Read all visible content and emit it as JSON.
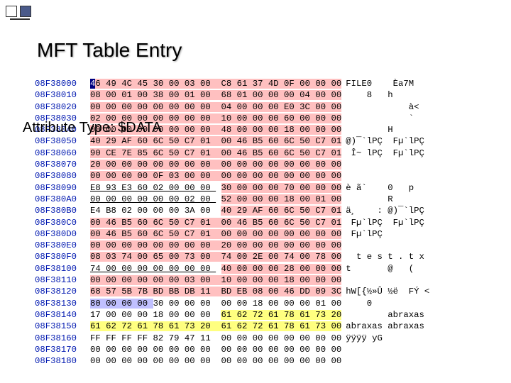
{
  "title": "MFT Table Entry",
  "label": "Attribute Type: $DATA",
  "colors": {
    "pink": "#ffc0c0",
    "blue": "#c0c0ff",
    "yellow": "#ffff80",
    "selection": "#000080",
    "address": "#0018b0"
  },
  "rows": [
    {
      "addr": "08F38000",
      "bytes": "46 49 4C 45 30 00 03 00  C8 61 37 4D 0F 00 00 00",
      "ascii": "FILE0    Èa7M     "
    },
    {
      "addr": "08F38010",
      "bytes": "08 00 01 00 38 00 01 00  68 01 00 00 00 04 00 00",
      "ascii": "    8   h         "
    },
    {
      "addr": "08F38020",
      "bytes": "00 00 00 00 00 00 00 00  04 00 00 00 E0 3C 00 00",
      "ascii": "            à<    "
    },
    {
      "addr": "08F38030",
      "bytes": "02 00 00 00 00 00 00 00  10 00 00 00 60 00 00 00",
      "ascii": "            `     "
    },
    {
      "addr": "08F38040",
      "bytes": "00 00 00 00 00 00 00 00  48 00 00 00 18 00 00 00",
      "ascii": "        H         "
    },
    {
      "addr": "08F38050",
      "bytes": "40 29 AF 60 6C 50 C7 01  00 46 B5 60 6C 50 C7 01",
      "ascii": "@)¯`lPÇ  Fµ`lPÇ"
    },
    {
      "addr": "08F38060",
      "bytes": "90 CE 7E 85 6C 50 C7 01  00 46 B5 60 6C 50 C7 01",
      "ascii": " Î~ lPÇ  Fµ`lPÇ"
    },
    {
      "addr": "08F38070",
      "bytes": "20 00 00 00 00 00 00 00  00 00 00 00 00 00 00 00",
      "ascii": "                  "
    },
    {
      "addr": "08F38080",
      "bytes": "00 00 00 00 0F 03 00 00  00 00 00 00 00 00 00 00",
      "ascii": "                  "
    },
    {
      "addr": "08F38090",
      "bytes": "E8 93 E3 60 02 00 00 00  30 00 00 00 70 00 00 00",
      "ascii": "è ã`    0   p     "
    },
    {
      "addr": "08F380A0",
      "bytes": "00 00 00 00 00 00 02 00  52 00 00 00 18 00 01 00",
      "ascii": "        R         "
    },
    {
      "addr": "08F380B0",
      "bytes": "E4 B8 02 00 00 00 3A 00  40 29 AF 60 6C 50 C7 01",
      "ascii": "ä¸    : @)¯`lPÇ"
    },
    {
      "addr": "08F380C0",
      "bytes": "00 46 B5 60 6C 50 C7 01  00 46 B5 60 6C 50 C7 01",
      "ascii": " Fµ`lPÇ  Fµ`lPÇ"
    },
    {
      "addr": "08F380D0",
      "bytes": "00 46 B5 60 6C 50 C7 01  00 00 00 00 00 00 00 00",
      "ascii": " Fµ`lPÇ          "
    },
    {
      "addr": "08F380E0",
      "bytes": "00 00 00 00 00 00 00 00  20 00 00 00 00 00 00 00",
      "ascii": "                  "
    },
    {
      "addr": "08F380F0",
      "bytes": "08 03 74 00 65 00 73 00  74 00 2E 00 74 00 78 00",
      "ascii": "  t e s t . t x "
    },
    {
      "addr": "08F38100",
      "bytes": "74 00 00 00 00 00 00 00  40 00 00 00 28 00 00 00",
      "ascii": "t       @   (     "
    },
    {
      "addr": "08F38110",
      "bytes": "00 00 00 00 00 00 03 00  10 00 00 00 18 00 00 00",
      "ascii": "                  "
    },
    {
      "addr": "08F38120",
      "bytes": "68 57 5B 7B BD BB DB 11  BD EB 08 00 46 DD 09 3C",
      "ascii": "hW[{½»Û ½ë  FÝ <"
    },
    {
      "addr": "08F38130",
      "bytes": "80 00 00 00 30 00 00 00  00 00 18 00 00 00 01 00",
      "ascii": "    0             "
    },
    {
      "addr": "08F38140",
      "bytes": "17 00 00 00 18 00 00 00  61 62 72 61 78 61 73 20",
      "ascii": "        abraxas "
    },
    {
      "addr": "08F38150",
      "bytes": "61 62 72 61 78 61 73 20  61 62 72 61 78 61 73 00",
      "ascii": "abraxas abraxas "
    },
    {
      "addr": "08F38160",
      "bytes": "FF FF FF FF 82 79 47 11  00 00 00 00 00 00 00 00",
      "ascii": "ÿÿÿÿ yG          "
    },
    {
      "addr": "08F38170",
      "bytes": "00 00 00 00 00 00 00 00  00 00 00 00 00 00 00 00",
      "ascii": "                  "
    },
    {
      "addr": "08F38180",
      "bytes": "00 00 00 00 00 00 00 00  00 00 00 00 00 00 00 00",
      "ascii": "                  "
    }
  ],
  "highlights": {
    "pink": [
      {
        "row": 0,
        "start": 0,
        "end": 47
      },
      {
        "row": 1,
        "start": 0,
        "end": 47
      },
      {
        "row": 2,
        "start": 0,
        "end": 47
      },
      {
        "row": 3,
        "start": 0,
        "end": 47
      },
      {
        "row": 4,
        "start": 0,
        "end": 47
      },
      {
        "row": 5,
        "start": 0,
        "end": 47
      },
      {
        "row": 6,
        "start": 0,
        "end": 47
      },
      {
        "row": 7,
        "start": 0,
        "end": 47
      },
      {
        "row": 8,
        "start": 0,
        "end": 47
      },
      {
        "row": 9,
        "start": 25,
        "end": 47
      },
      {
        "row": 10,
        "start": 25,
        "end": 47
      },
      {
        "row": 11,
        "start": 25,
        "end": 47
      },
      {
        "row": 12,
        "start": 0,
        "end": 47
      },
      {
        "row": 13,
        "start": 0,
        "end": 47
      },
      {
        "row": 14,
        "start": 0,
        "end": 47
      },
      {
        "row": 15,
        "start": 0,
        "end": 47
      },
      {
        "row": 16,
        "start": 25,
        "end": 47
      },
      {
        "row": 17,
        "start": 0,
        "end": 47
      },
      {
        "row": 18,
        "start": 0,
        "end": 47
      }
    ],
    "underline": [
      {
        "row": 9,
        "start": 0,
        "end": 23
      },
      {
        "row": 10,
        "start": 0,
        "end": 23
      },
      {
        "row": 16,
        "start": 0,
        "end": 23
      }
    ],
    "blue": [
      {
        "row": 19,
        "start": 0,
        "end": 11
      }
    ],
    "yellow": [
      {
        "row": 20,
        "start": 25,
        "end": 47
      },
      {
        "row": 21,
        "start": 0,
        "end": 47
      }
    ]
  }
}
